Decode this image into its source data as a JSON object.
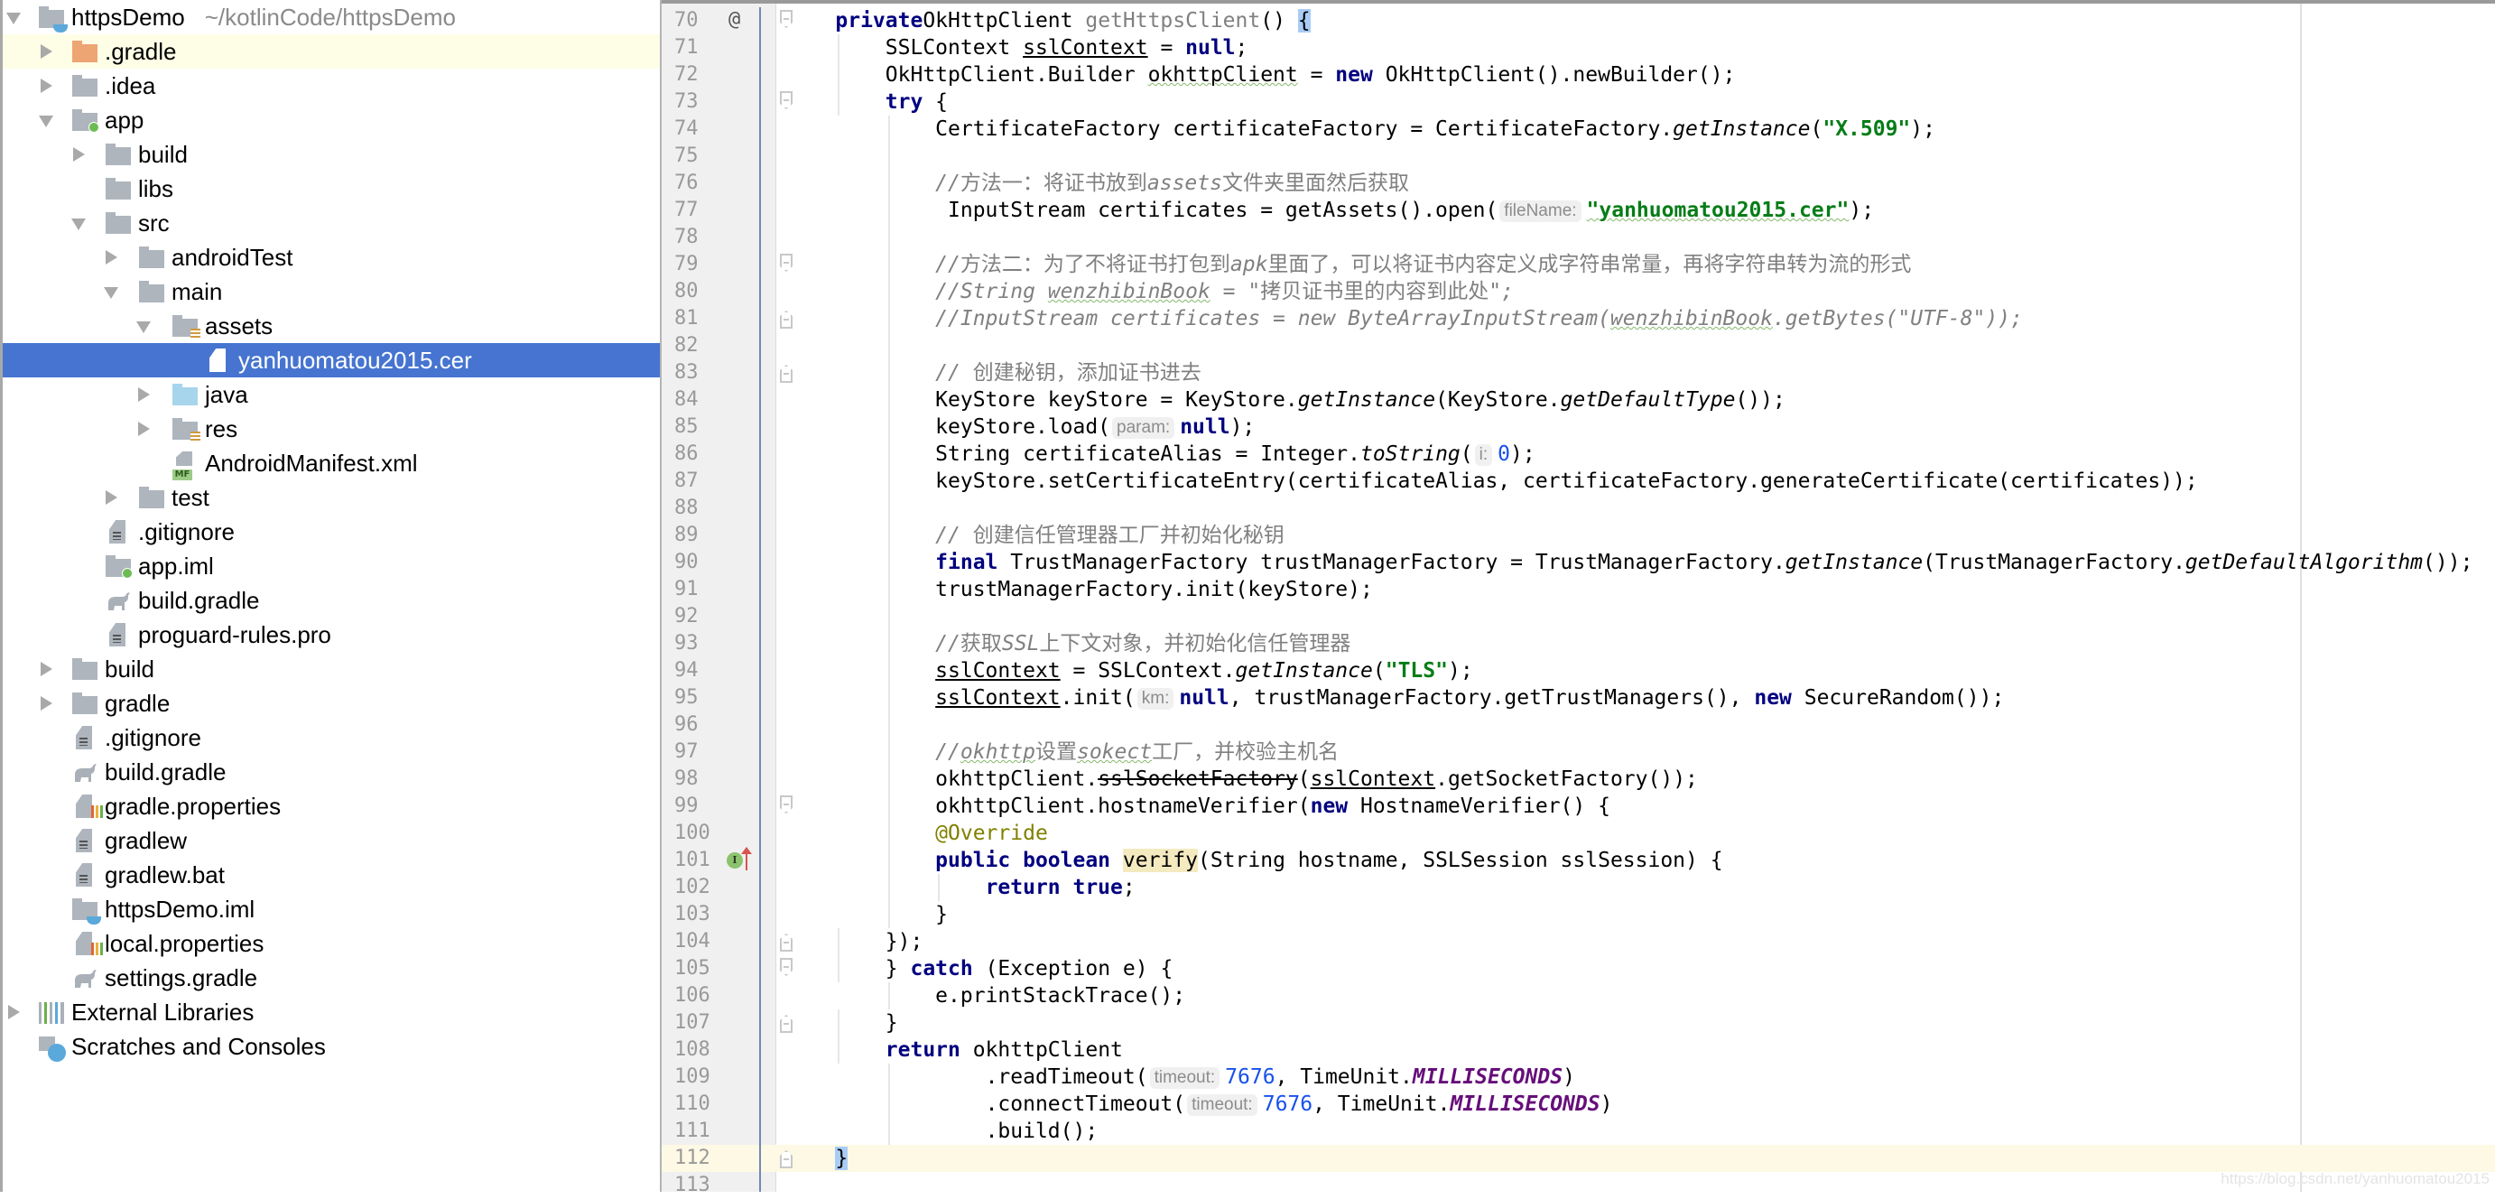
{
  "project_tree": {
    "root": {
      "label": "httpsDemo",
      "path": "~/kotlinCode/httpsDemo"
    },
    "rows": [
      {
        "label": "httpsDemo",
        "level": 0,
        "toggle": "expanded",
        "icon": "project-module-icon",
        "kind": "root"
      },
      {
        "label": ".gradle",
        "level": 1,
        "toggle": "collapsed",
        "icon": "excluded-folder-icon",
        "kind": "folder-orange",
        "state": "hover"
      },
      {
        "label": ".idea",
        "level": 1,
        "toggle": "collapsed",
        "icon": "folder-icon",
        "kind": "folder"
      },
      {
        "label": "app",
        "level": 1,
        "toggle": "expanded",
        "icon": "module-folder-icon",
        "kind": "folder-module"
      },
      {
        "label": "build",
        "level": 2,
        "toggle": "collapsed",
        "icon": "folder-icon",
        "kind": "folder"
      },
      {
        "label": "libs",
        "level": 2,
        "toggle": "none",
        "icon": "folder-icon",
        "kind": "folder"
      },
      {
        "label": "src",
        "level": 2,
        "toggle": "expanded",
        "icon": "folder-icon",
        "kind": "folder"
      },
      {
        "label": "androidTest",
        "level": 3,
        "toggle": "collapsed",
        "icon": "folder-icon",
        "kind": "folder"
      },
      {
        "label": "main",
        "level": 3,
        "toggle": "expanded",
        "icon": "folder-icon",
        "kind": "folder"
      },
      {
        "label": "assets",
        "level": 4,
        "toggle": "expanded",
        "icon": "resource-folder-icon",
        "kind": "folder-res"
      },
      {
        "label": "yanhuomatou2015.cer",
        "level": 5,
        "toggle": "none",
        "icon": "file-icon",
        "kind": "file-white",
        "state": "selected"
      },
      {
        "label": "java",
        "level": 4,
        "toggle": "collapsed",
        "icon": "source-folder-icon",
        "kind": "folder-blue"
      },
      {
        "label": "res",
        "level": 4,
        "toggle": "collapsed",
        "icon": "resource-folder-icon",
        "kind": "folder-res"
      },
      {
        "label": "AndroidManifest.xml",
        "level": 4,
        "toggle": "none",
        "icon": "manifest-file-icon",
        "kind": "manifest"
      },
      {
        "label": "test",
        "level": 3,
        "toggle": "collapsed",
        "icon": "folder-icon",
        "kind": "folder"
      },
      {
        "label": ".gitignore",
        "level": 2,
        "toggle": "none",
        "icon": "text-file-icon",
        "kind": "textfile"
      },
      {
        "label": "app.iml",
        "level": 2,
        "toggle": "none",
        "icon": "module-file-icon",
        "kind": "folder-module"
      },
      {
        "label": "build.gradle",
        "level": 2,
        "toggle": "none",
        "icon": "gradle-elephant-icon",
        "kind": "gradle"
      },
      {
        "label": "proguard-rules.pro",
        "level": 2,
        "toggle": "none",
        "icon": "text-file-icon",
        "kind": "textfile"
      },
      {
        "label": "build",
        "level": 1,
        "toggle": "collapsed",
        "icon": "folder-icon",
        "kind": "folder"
      },
      {
        "label": "gradle",
        "level": 1,
        "toggle": "collapsed",
        "icon": "folder-icon",
        "kind": "folder"
      },
      {
        "label": ".gitignore",
        "level": 1,
        "toggle": "none",
        "icon": "text-file-icon",
        "kind": "textfile"
      },
      {
        "label": "build.gradle",
        "level": 1,
        "toggle": "none",
        "icon": "gradle-elephant-icon",
        "kind": "gradle"
      },
      {
        "label": "gradle.properties",
        "level": 1,
        "toggle": "none",
        "icon": "properties-file-icon",
        "kind": "props"
      },
      {
        "label": "gradlew",
        "level": 1,
        "toggle": "none",
        "icon": "text-file-icon",
        "kind": "textfile"
      },
      {
        "label": "gradlew.bat",
        "level": 1,
        "toggle": "none",
        "icon": "text-file-icon",
        "kind": "textfile"
      },
      {
        "label": "httpsDemo.iml",
        "level": 1,
        "toggle": "none",
        "icon": "module-file-icon",
        "kind": "root"
      },
      {
        "label": "local.properties",
        "level": 1,
        "toggle": "none",
        "icon": "properties-file-icon",
        "kind": "props"
      },
      {
        "label": "settings.gradle",
        "level": 1,
        "toggle": "none",
        "icon": "gradle-elephant-icon",
        "kind": "gradle"
      },
      {
        "label": "External Libraries",
        "level": 0,
        "toggle": "collapsed",
        "icon": "library-icon",
        "kind": "libs"
      },
      {
        "label": "Scratches and Consoles",
        "level": 0,
        "toggle": "none",
        "icon": "scratches-icon",
        "kind": "scratch"
      }
    ]
  },
  "editor": {
    "current_line": 112,
    "lines": [
      {
        "n": 70,
        "indent": 4,
        "gutter_mark": "@",
        "fold": "open",
        "tokens": [
          [
            "kw",
            "private"
          ],
          [
            "",
            "OkHttpClient "
          ],
          [
            "unused",
            "getHttpsClient"
          ],
          [
            "",
            "() "
          ],
          [
            "brace",
            "{"
          ]
        ]
      },
      {
        "n": 71,
        "indent": 8,
        "tokens": [
          [
            "",
            "SSLContext "
          ],
          [
            "under",
            "sslContext"
          ],
          [
            "",
            " = "
          ],
          [
            "kw",
            "null"
          ],
          [
            "",
            ";"
          ]
        ]
      },
      {
        "n": 72,
        "indent": 8,
        "tokens": [
          [
            "",
            "OkHttpClient.Builder "
          ],
          [
            "wavy",
            "okhttpClient"
          ],
          [
            "",
            " = "
          ],
          [
            "kw",
            "new"
          ],
          [
            "",
            " OkHttpClient().newBuilder();"
          ]
        ]
      },
      {
        "n": 73,
        "indent": 8,
        "fold": "open",
        "tokens": [
          [
            "kw",
            "try"
          ],
          [
            "",
            " {"
          ]
        ]
      },
      {
        "n": 74,
        "indent": 12,
        "tokens": [
          [
            "",
            "CertificateFactory certificateFactory = CertificateFactory."
          ],
          [
            "ital",
            "getInstance"
          ],
          [
            "",
            "("
          ],
          [
            "str",
            "\"X.509\""
          ],
          [
            "",
            ");"
          ]
        ]
      },
      {
        "n": 75,
        "indent": 0,
        "tokens": []
      },
      {
        "n": 76,
        "indent": 12,
        "tokens": [
          [
            "com",
            "//"
          ],
          [
            "comcn",
            "方法一：将证书放到"
          ],
          [
            "com",
            "assets"
          ],
          [
            "comcn",
            "文件夹里面然后获取"
          ]
        ]
      },
      {
        "n": 77,
        "indent": 13,
        "tokens": [
          [
            "",
            "InputStream certificates = getAssets().open("
          ],
          [
            "hint",
            "fileName:"
          ],
          [
            "str-wavy",
            "\"yanhuomatou2015.cer\""
          ],
          [
            "",
            ");"
          ]
        ]
      },
      {
        "n": 78,
        "indent": 0,
        "tokens": []
      },
      {
        "n": 79,
        "indent": 12,
        "fold": "open",
        "tokens": [
          [
            "com",
            "//"
          ],
          [
            "comcn",
            "方法二：为了不将证书打包到"
          ],
          [
            "com",
            "apk"
          ],
          [
            "comcn",
            "里面了，可以将证书内容定义成字符串常量，再将字符串转为流的形式"
          ]
        ]
      },
      {
        "n": 80,
        "indent": 12,
        "tokens": [
          [
            "com",
            "//String "
          ],
          [
            "com-wavy",
            "wenzhibinBook"
          ],
          [
            "com",
            " = \""
          ],
          [
            "comcn",
            "拷贝证书里的内容到此处"
          ],
          [
            "com",
            "\";"
          ]
        ]
      },
      {
        "n": 81,
        "indent": 12,
        "fold": "close",
        "tokens": [
          [
            "com",
            "//InputStream certificates = new ByteArrayInputStream("
          ],
          [
            "com-wavy",
            "wenzhibinBook"
          ],
          [
            "com",
            ".getBytes(\"UTF-8\"));"
          ]
        ]
      },
      {
        "n": 82,
        "indent": 0,
        "tokens": []
      },
      {
        "n": 83,
        "indent": 12,
        "fold": "close",
        "tokens": [
          [
            "com",
            "// "
          ],
          [
            "comcn",
            "创建秘钥，添加证书进去"
          ]
        ]
      },
      {
        "n": 84,
        "indent": 12,
        "tokens": [
          [
            "",
            "KeyStore keyStore = KeyStore."
          ],
          [
            "ital",
            "getInstance"
          ],
          [
            "",
            "(KeyStore."
          ],
          [
            "ital",
            "getDefaultType"
          ],
          [
            "",
            "());"
          ]
        ]
      },
      {
        "n": 85,
        "indent": 12,
        "tokens": [
          [
            "",
            "keyStore.load("
          ],
          [
            "hint",
            "param:"
          ],
          [
            "kw",
            "null"
          ],
          [
            "",
            ");"
          ]
        ]
      },
      {
        "n": 86,
        "indent": 12,
        "tokens": [
          [
            "",
            "String certificateAlias = Integer."
          ],
          [
            "ital",
            "toString"
          ],
          [
            "",
            "("
          ],
          [
            "hint",
            "i:"
          ],
          [
            "num",
            "0"
          ],
          [
            "",
            ");"
          ]
        ]
      },
      {
        "n": 87,
        "indent": 12,
        "tokens": [
          [
            "",
            "keyStore.setCertificateEntry(certificateAlias, certificateFactory.generateCertificate(certificates));"
          ]
        ]
      },
      {
        "n": 88,
        "indent": 0,
        "tokens": []
      },
      {
        "n": 89,
        "indent": 12,
        "tokens": [
          [
            "com",
            "// "
          ],
          [
            "comcn",
            "创建信任管理器工厂并初始化秘钥"
          ]
        ]
      },
      {
        "n": 90,
        "indent": 12,
        "tokens": [
          [
            "kw",
            "final"
          ],
          [
            "",
            " TrustManagerFactory trustManagerFactory = TrustManagerFactory."
          ],
          [
            "ital",
            "getInstance"
          ],
          [
            "",
            "(TrustManagerFactory."
          ],
          [
            "ital",
            "getDefaultAlgorithm"
          ],
          [
            "",
            "());"
          ]
        ]
      },
      {
        "n": 91,
        "indent": 12,
        "tokens": [
          [
            "",
            "trustManagerFactory.init(keyStore);"
          ]
        ]
      },
      {
        "n": 92,
        "indent": 0,
        "tokens": []
      },
      {
        "n": 93,
        "indent": 12,
        "tokens": [
          [
            "com",
            "//"
          ],
          [
            "comcn",
            "获取"
          ],
          [
            "com",
            "SSL"
          ],
          [
            "comcn",
            "上下文对象，并初始化信任管理器"
          ]
        ]
      },
      {
        "n": 94,
        "indent": 12,
        "tokens": [
          [
            "under",
            "sslContext"
          ],
          [
            "",
            " = SSLContext."
          ],
          [
            "ital",
            "getInstance"
          ],
          [
            "",
            "("
          ],
          [
            "str",
            "\"TLS\""
          ],
          [
            "",
            ");"
          ]
        ]
      },
      {
        "n": 95,
        "indent": 12,
        "tokens": [
          [
            "under",
            "sslContext"
          ],
          [
            "",
            ".init("
          ],
          [
            "hint",
            "km:"
          ],
          [
            "kw",
            "null"
          ],
          [
            "",
            ", trustManagerFactory.getTrustManagers(), "
          ],
          [
            "kw",
            "new"
          ],
          [
            "",
            " SecureRandom());"
          ]
        ]
      },
      {
        "n": 96,
        "indent": 0,
        "tokens": []
      },
      {
        "n": 97,
        "indent": 12,
        "tokens": [
          [
            "com",
            "//"
          ],
          [
            "com-wavy",
            "okhttp"
          ],
          [
            "comcn",
            "设置"
          ],
          [
            "com-wavy",
            "sokect"
          ],
          [
            "comcn",
            "工厂，并校验主机名"
          ]
        ]
      },
      {
        "n": 98,
        "indent": 12,
        "tokens": [
          [
            "",
            "okhttpClient."
          ],
          [
            "strike",
            "sslSocketFactory"
          ],
          [
            "",
            "("
          ],
          [
            "under",
            "sslContext"
          ],
          [
            "",
            ".getSocketFactory());"
          ]
        ]
      },
      {
        "n": 99,
        "indent": 12,
        "fold": "open",
        "tokens": [
          [
            "",
            "okhttpClient.hostnameVerifier("
          ],
          [
            "kw",
            "new"
          ],
          [
            "",
            " HostnameVerifier() {"
          ]
        ]
      },
      {
        "n": 100,
        "indent": 12,
        "tokens": [
          [
            "anno",
            "@Override"
          ]
        ]
      },
      {
        "n": 101,
        "indent": 12,
        "gutter_mark": "implements",
        "tokens": [
          [
            "kw",
            "public boolean "
          ],
          [
            "usage",
            "verify"
          ],
          [
            "",
            "(String hostname, SSLSession sslSession) {"
          ]
        ]
      },
      {
        "n": 102,
        "indent": 16,
        "tokens": [
          [
            "kw",
            "return true"
          ],
          [
            "",
            ";"
          ]
        ]
      },
      {
        "n": 103,
        "indent": 12,
        "tokens": [
          [
            "",
            "}"
          ]
        ]
      },
      {
        "n": 104,
        "indent": 8,
        "fold": "close",
        "tokens": [
          [
            "",
            "});"
          ]
        ]
      },
      {
        "n": 105,
        "indent": 8,
        "fold": "open",
        "tokens": [
          [
            "",
            "} "
          ],
          [
            "kw",
            "catch"
          ],
          [
            "",
            " (Exception e) {"
          ]
        ]
      },
      {
        "n": 106,
        "indent": 12,
        "tokens": [
          [
            "",
            "e.printStackTrace();"
          ]
        ]
      },
      {
        "n": 107,
        "indent": 8,
        "fold": "close",
        "tokens": [
          [
            "",
            "}"
          ]
        ]
      },
      {
        "n": 108,
        "indent": 8,
        "tokens": [
          [
            "kw",
            "return"
          ],
          [
            "",
            " okhttpClient"
          ]
        ]
      },
      {
        "n": 109,
        "indent": 16,
        "tokens": [
          [
            "",
            ".readTimeout("
          ],
          [
            "hint",
            "timeout:"
          ],
          [
            "num",
            "7676"
          ],
          [
            "",
            ", TimeUnit."
          ],
          [
            "static",
            "MILLISECONDS"
          ],
          [
            "",
            ")"
          ]
        ]
      },
      {
        "n": 110,
        "indent": 16,
        "tokens": [
          [
            "",
            ".connectTimeout("
          ],
          [
            "hint",
            "timeout:"
          ],
          [
            "num",
            "7676"
          ],
          [
            "",
            ", TimeUnit."
          ],
          [
            "static",
            "MILLISECONDS"
          ],
          [
            "",
            ")"
          ]
        ]
      },
      {
        "n": 111,
        "indent": 16,
        "tokens": [
          [
            "",
            ".build();"
          ]
        ]
      },
      {
        "n": 112,
        "indent": 4,
        "fold": "close",
        "tokens": [
          [
            "brace",
            "}"
          ]
        ]
      },
      {
        "n": 113,
        "indent": 0,
        "tokens": []
      }
    ]
  },
  "watermark": "https://blog.csdn.net/yanhuomatou2015",
  "colors": {
    "selection": "#4674d0",
    "hover_row": "#fefde6",
    "keyword": "#000080",
    "string": "#067d17",
    "number": "#1750eb",
    "comment": "#808080",
    "static_field": "#660e7a",
    "annotation": "#808000",
    "current_line": "#fdf9e4"
  }
}
